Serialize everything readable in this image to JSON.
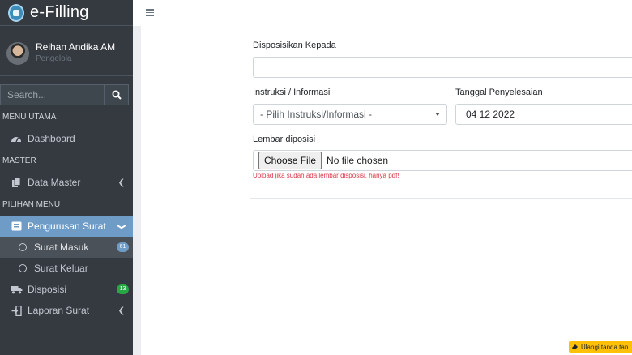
{
  "brand": {
    "title": "e-Filling"
  },
  "user": {
    "name": "Reihan Andika AM",
    "role": "Pengelola"
  },
  "search": {
    "placeholder": "Search..."
  },
  "sidebar": {
    "headers": [
      "MENU UTAMA",
      "MASTER",
      "PILIHAN MENU"
    ],
    "items": [
      {
        "label": "Dashboard",
        "icon": "dashboard-icon"
      },
      {
        "label": "Data Master",
        "icon": "copy-icon"
      },
      {
        "label": "Pengurusan Surat",
        "icon": "inbox-icon"
      },
      {
        "label": "Surat Masuk",
        "icon": "circle-icon",
        "badge": "61"
      },
      {
        "label": "Surat Keluar",
        "icon": "circle-icon"
      },
      {
        "label": "Disposisi",
        "icon": "truck-icon",
        "badge": "13"
      },
      {
        "label": "Laporan Surat",
        "icon": "sign-in-icon"
      }
    ]
  },
  "form": {
    "disposisikan_label": "Disposisikan Kepada",
    "disposisikan_value": "",
    "instruksi_label": "Instruksi / Informasi",
    "instruksi_value": "- Pilih Instruksi/Informasi -",
    "tanggal_label": "Tanggal Penyelesaian",
    "tanggal_value": "04 12  2022",
    "lembar_label": "Lembar diposisi",
    "file_button": "Choose File",
    "file_status": "No file chosen",
    "help_text": "Upload jika sudah ada lembar disposisi, hanya pdf!"
  },
  "actions": {
    "reset_label": "Ulangi tanda tan"
  },
  "colors": {
    "sidebar": "#343a40",
    "active": "#6f9cc7",
    "danger": "#dc3545",
    "warning": "#ffc107",
    "success": "#28a745"
  }
}
